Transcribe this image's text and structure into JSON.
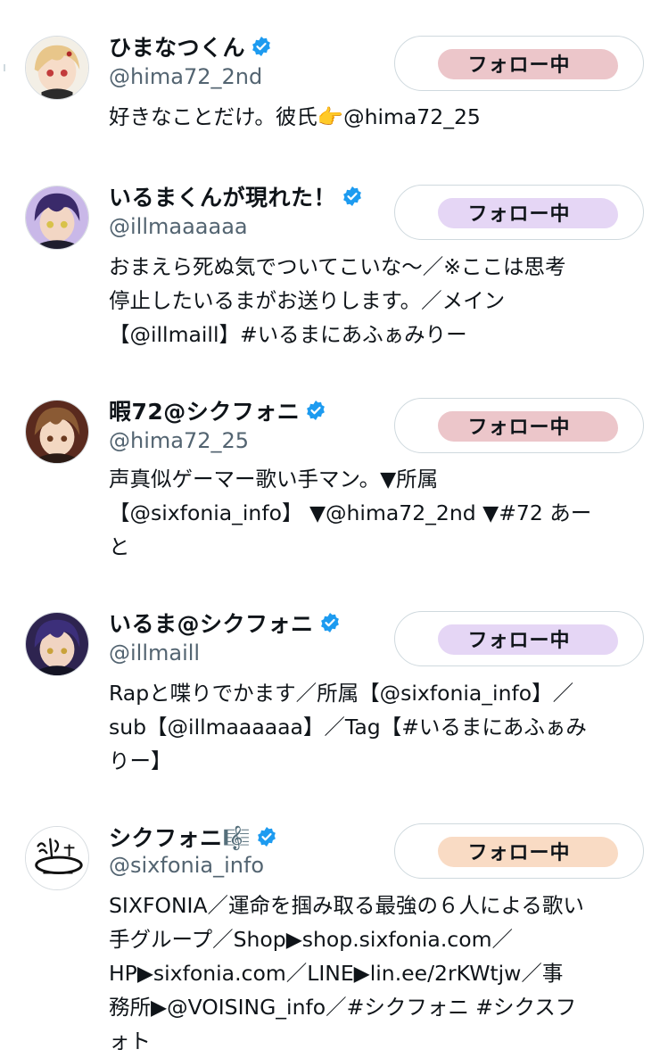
{
  "colors": {
    "verified": "#1d9bf0",
    "handle": "#536471",
    "text": "#0f1419",
    "button_border": "#cfd9de"
  },
  "users": [
    {
      "display_name": "ひまなつくん",
      "verified": true,
      "handle": "@hima72_2nd",
      "bio": "好きなことだけ。彼氏👉@hima72_25",
      "follow_label": "フォロー中",
      "highlight_color": "#e6b3b8",
      "avatar_icon": "blond-boy-avatar-icon"
    },
    {
      "display_name": "いるまくんが現れた！",
      "verified": true,
      "handle": "@illmaaaaaa",
      "bio": "おまえら死ぬ気でついてこいな〜／※ここは思考\n停止したいるまがお送りします。／メイン\n【@illmaill】#いるまにあふぁみりー",
      "follow_label": "フォロー中",
      "highlight_color": "#dcc8f2",
      "avatar_icon": "purple-hair-boy-avatar-icon"
    },
    {
      "display_name": "暇72@シクフォニ",
      "verified": true,
      "handle": "@hima72_25",
      "bio": "声真似ゲーマー歌い手マン。▼所属\n【@sixfonia_info】 ▼@hima72_2nd ▼#72 あー\nと",
      "follow_label": "フォロー中",
      "highlight_color": "#e6b3b8",
      "avatar_icon": "brown-hair-boy-avatar-icon"
    },
    {
      "display_name": "いるま@シクフォニ",
      "verified": true,
      "handle": "@illmaill",
      "bio": "Rapと喋りでかます／所属【@sixfonia_info】／\nsub【@illmaaaaaa】／Tag【#いるまにあふぁみ\nりー】",
      "follow_label": "フォロー中",
      "highlight_color": "#dcc8f2",
      "avatar_icon": "dark-purple-hair-boy-avatar-icon"
    },
    {
      "display_name": "シクフォニ🎼",
      "verified": true,
      "handle": "@sixfonia_info",
      "bio": "SIXFONIA／運命を掴み取る最強の６人による歌い\n手グループ／Shop▶shop.sixfonia.com／\nHP▶sixfonia.com／LINE▶lin.ee/2rKWtjw／事\n務所▶@VOISING_info／#シクフォニ #シクスフ\nォト",
      "follow_label": "フォロー中",
      "highlight_color": "#f7cfb0",
      "avatar_icon": "sixfonia-logo-icon"
    }
  ]
}
